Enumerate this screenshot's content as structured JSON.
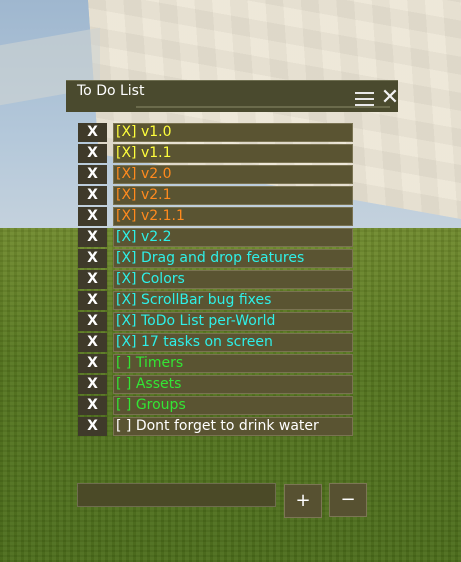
{
  "window": {
    "title": "To Do List",
    "menu_icon": "hamburger-menu-icon",
    "close_glyph": "✕"
  },
  "tasks": [
    {
      "text": "[X] v1.0",
      "color": "#ffff3c"
    },
    {
      "text": "[X] v1.1",
      "color": "#ffff3c"
    },
    {
      "text": "[X] v2.0",
      "color": "#ff8a1e"
    },
    {
      "text": "[X] v2.1",
      "color": "#ff8a1e"
    },
    {
      "text": "[X] v2.1.1",
      "color": "#ff8a1e"
    },
    {
      "text": "[X] v2.2",
      "color": "#2ef0e8"
    },
    {
      "text": "[X] Drag and drop features",
      "color": "#2ef0e8"
    },
    {
      "text": "[X] Colors",
      "color": "#2ef0e8"
    },
    {
      "text": "[X] ScrollBar bug fixes",
      "color": "#2ef0e8"
    },
    {
      "text": "[X] ToDo List per-World",
      "color": "#2ef0e8"
    },
    {
      "text": "[X] 17 tasks on screen",
      "color": "#2ef0e8"
    },
    {
      "text": "[ ] Timers",
      "color": "#33e634"
    },
    {
      "text": "[ ] Assets",
      "color": "#33e634"
    },
    {
      "text": "[ ] Groups",
      "color": "#33e634"
    },
    {
      "text": "[ ] Dont forget to drink water",
      "color": "#ffffff"
    }
  ],
  "delete_label": "X",
  "new_task": {
    "value": "",
    "placeholder": ""
  },
  "add_label": "+",
  "remove_label": "−"
}
